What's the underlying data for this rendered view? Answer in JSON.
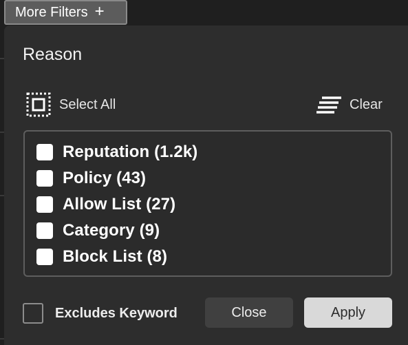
{
  "toolbar": {
    "more_filters_label": "More Filters",
    "more_filters_icon": "plus-icon"
  },
  "panel": {
    "title": "Reason",
    "select_all_label": "Select All",
    "select_all_icon": "select-all-icon",
    "clear_label": "Clear",
    "clear_icon": "clear-lines-icon",
    "items": [
      {
        "label": "Reputation (1.2k)",
        "checked": false
      },
      {
        "label": "Policy (43)",
        "checked": false
      },
      {
        "label": "Allow List (27)",
        "checked": false
      },
      {
        "label": "Category (9)",
        "checked": false
      },
      {
        "label": "Block List (8)",
        "checked": false
      }
    ],
    "excludes_label": "Excludes Keyword",
    "excludes_checked": false,
    "close_label": "Close",
    "apply_label": "Apply"
  },
  "colors": {
    "panel_bg": "#2d2d2d",
    "button_bg": "#5c5c5c",
    "apply_bg": "#d9d9d9"
  }
}
